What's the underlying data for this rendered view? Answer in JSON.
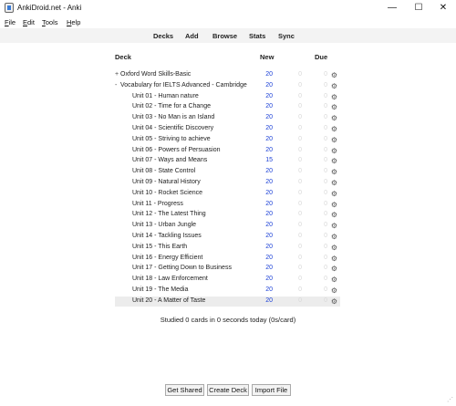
{
  "window": {
    "title": "AnkiDroid.net - Anki",
    "minimize": "—",
    "maximize": "☐",
    "close": "✕"
  },
  "menu": {
    "items": [
      {
        "underline": "F",
        "rest": "ile"
      },
      {
        "underline": "E",
        "rest": "dit"
      },
      {
        "underline": "T",
        "rest": "ools"
      },
      {
        "underline": "H",
        "rest": "elp"
      }
    ]
  },
  "toolbar": {
    "decks": "Decks",
    "add": "Add",
    "browse": "Browse",
    "stats": "Stats",
    "sync": "Sync"
  },
  "deck_table": {
    "headers": {
      "deck": "Deck",
      "new": "New",
      "due": "Due"
    },
    "rows": [
      {
        "twist": "+",
        "name": "Oxford Word Skills-Basic",
        "new": "20",
        "learn": "0",
        "due": "0",
        "level": 0
      },
      {
        "twist": "-",
        "name": "Vocabulary for IELTS Advanced - Cambridge",
        "new": "20",
        "learn": "0",
        "due": "0",
        "level": 0
      },
      {
        "twist": "",
        "name": "Unit 01 - Human nature",
        "new": "20",
        "learn": "0",
        "due": "0",
        "level": 1
      },
      {
        "twist": "",
        "name": "Unit 02 - Time for a Change",
        "new": "20",
        "learn": "0",
        "due": "0",
        "level": 1
      },
      {
        "twist": "",
        "name": "Unit 03 - No Man is an Island",
        "new": "20",
        "learn": "0",
        "due": "0",
        "level": 1
      },
      {
        "twist": "",
        "name": "Unit 04 - Scientific Discovery",
        "new": "20",
        "learn": "0",
        "due": "0",
        "level": 1
      },
      {
        "twist": "",
        "name": "Unit 05 - Striving to achieve",
        "new": "20",
        "learn": "0",
        "due": "0",
        "level": 1
      },
      {
        "twist": "",
        "name": "Unit 06 - Powers of Persuasion",
        "new": "20",
        "learn": "0",
        "due": "0",
        "level": 1
      },
      {
        "twist": "",
        "name": "Unit 07 - Ways and Means",
        "new": "15",
        "learn": "0",
        "due": "0",
        "level": 1
      },
      {
        "twist": "",
        "name": "Unit 08 - State Control",
        "new": "20",
        "learn": "0",
        "due": "0",
        "level": 1
      },
      {
        "twist": "",
        "name": "Unit 09 - Natural History",
        "new": "20",
        "learn": "0",
        "due": "0",
        "level": 1
      },
      {
        "twist": "",
        "name": "Unit 10 - Rocket Science",
        "new": "20",
        "learn": "0",
        "due": "0",
        "level": 1
      },
      {
        "twist": "",
        "name": "Unit 11 - Progress",
        "new": "20",
        "learn": "0",
        "due": "0",
        "level": 1
      },
      {
        "twist": "",
        "name": "Unit 12 - The Latest Thing",
        "new": "20",
        "learn": "0",
        "due": "0",
        "level": 1
      },
      {
        "twist": "",
        "name": "Unit 13 - Urban Jungle",
        "new": "20",
        "learn": "0",
        "due": "0",
        "level": 1
      },
      {
        "twist": "",
        "name": "Unit 14 - Tackling Issues",
        "new": "20",
        "learn": "0",
        "due": "0",
        "level": 1
      },
      {
        "twist": "",
        "name": "Unit 15 - This Earth",
        "new": "20",
        "learn": "0",
        "due": "0",
        "level": 1
      },
      {
        "twist": "",
        "name": "Unit 16 - Energy Efficient",
        "new": "20",
        "learn": "0",
        "due": "0",
        "level": 1
      },
      {
        "twist": "",
        "name": "Unit 17 - Getting Down to Business",
        "new": "20",
        "learn": "0",
        "due": "0",
        "level": 1
      },
      {
        "twist": "",
        "name": "Unit 18 - Law Enforcement",
        "new": "20",
        "learn": "0",
        "due": "0",
        "level": 1
      },
      {
        "twist": "",
        "name": "Unit 19 - The Media",
        "new": "20",
        "learn": "0",
        "due": "0",
        "level": 1
      },
      {
        "twist": "",
        "name": "Unit 20 - A Matter of Taste",
        "new": "20",
        "learn": "0",
        "due": "0",
        "level": 1,
        "current": true
      }
    ],
    "gear_icon": "gear-icon"
  },
  "studied": "Studied 0 cards in 0 seconds today (0s/card)",
  "footer": {
    "get_shared": "Get Shared",
    "create_deck": "Create Deck",
    "import_file": "Import File"
  },
  "colors": {
    "new_count": "#1a3fd6",
    "zero_count": "#d8d8d8",
    "current_row": "#ececec"
  }
}
